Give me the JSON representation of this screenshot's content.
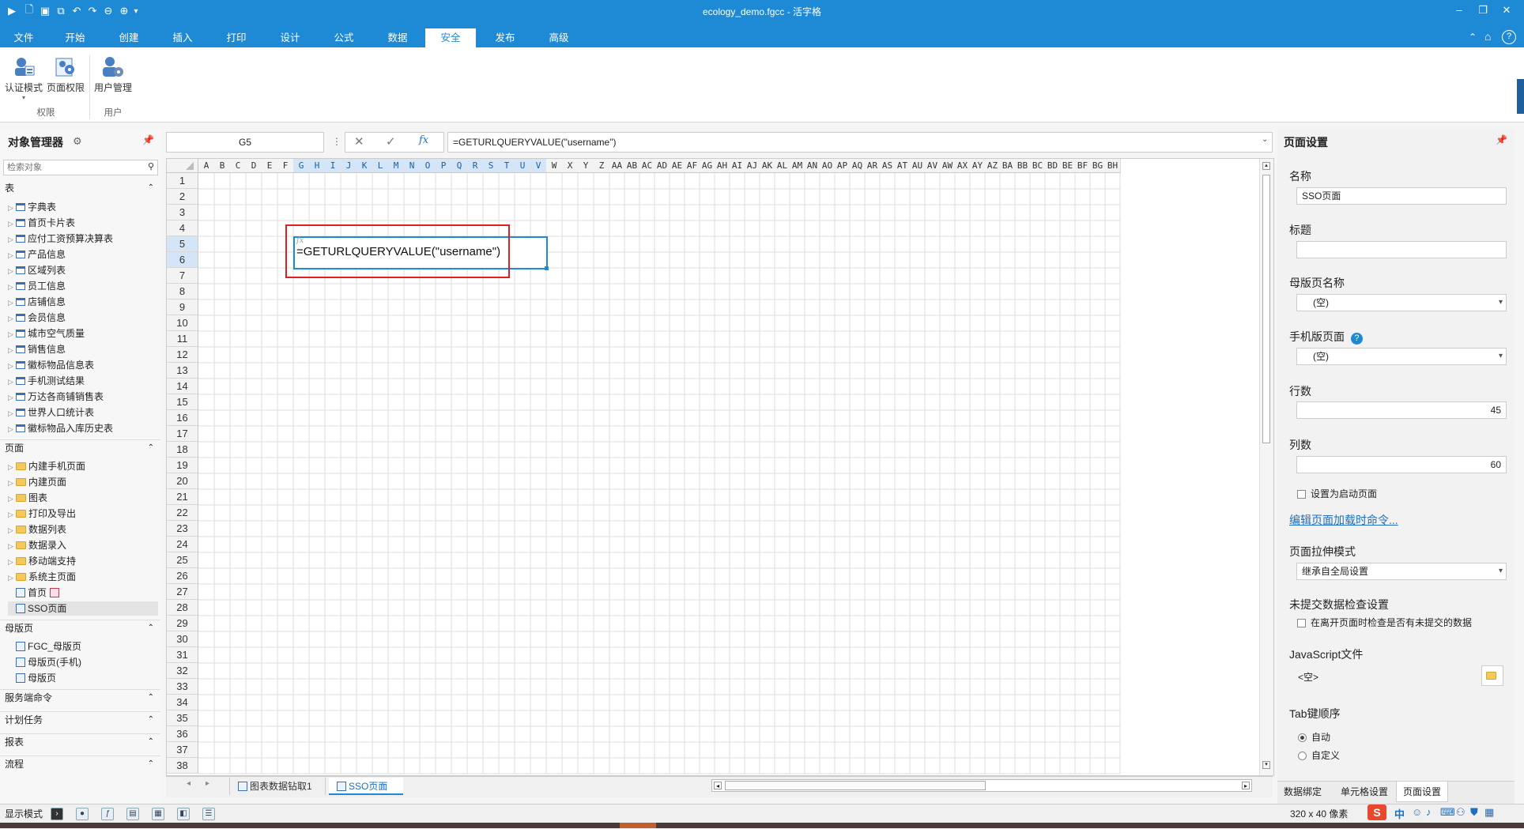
{
  "window": {
    "title": "ecology_demo.fgcc - 活字格",
    "controls": [
      "minimize-icon",
      "restore-icon",
      "close-icon"
    ]
  },
  "quick_access": [
    "run-icon",
    "new-icon",
    "save-icon",
    "open-icon",
    "undo-icon",
    "redo-icon",
    "back-icon",
    "forward-icon",
    "customize-icon"
  ],
  "menu": {
    "items": [
      "文件",
      "开始",
      "创建",
      "插入",
      "打印",
      "设计",
      "公式",
      "数据",
      "安全",
      "发布",
      "高级"
    ],
    "active": "安全"
  },
  "ribbon": {
    "buttons": [
      {
        "label": "认证模式",
        "icon": "auth-mode-icon"
      },
      {
        "label": "页面权限",
        "icon": "page-permission-icon"
      },
      {
        "label": "用户管理",
        "icon": "user-management-icon"
      }
    ],
    "groups": [
      "权限",
      "用户"
    ]
  },
  "object_manager": {
    "title": "对象管理器",
    "search_placeholder": "检索对象",
    "sections": {
      "tables": {
        "label": "表",
        "items": [
          "字典表",
          "首页卡片表",
          "应付工资预算决算表",
          "产品信息",
          "区域列表",
          "员工信息",
          "店铺信息",
          "会员信息",
          "城市空气质量",
          "销售信息",
          "徽标物品信息表",
          "手机测试结果",
          "万达各商铺销售表",
          "世界人口统计表",
          "徽标物品入库历史表"
        ]
      },
      "pages": {
        "label": "页面",
        "folders": [
          "内建手机页面",
          "内建页面",
          "图表",
          "打印及导出",
          "数据列表",
          "数据录入",
          "移动端支持",
          "系统主页面"
        ],
        "pages": [
          "首页",
          "SSO页面"
        ]
      },
      "master_pages": {
        "label": "母版页",
        "items": [
          "FGC_母版页",
          "母版页(手机)",
          "母版页"
        ]
      },
      "collapsed": [
        "服务端命令",
        "计划任务",
        "报表",
        "流程"
      ]
    }
  },
  "formula_bar": {
    "cell_ref": "G5",
    "formula": "=GETURLQUERYVALUE(\"username\")",
    "fx_label": "fx"
  },
  "grid": {
    "columns": [
      "A",
      "B",
      "C",
      "D",
      "E",
      "F",
      "G",
      "H",
      "I",
      "J",
      "K",
      "L",
      "M",
      "N",
      "O",
      "P",
      "Q",
      "R",
      "S",
      "T",
      "U",
      "V",
      "W",
      "X",
      "Y",
      "Z",
      "AA",
      "AB",
      "AC",
      "AD",
      "AE",
      "AF",
      "AG",
      "AH",
      "AI",
      "AJ",
      "AK",
      "AL",
      "AM",
      "AN",
      "AO",
      "AP",
      "AQ",
      "AR",
      "AS",
      "AT",
      "AU",
      "AV",
      "AW",
      "AX",
      "AY",
      "AZ",
      "BA",
      "BB",
      "BC",
      "BD",
      "BE",
      "BF",
      "BG",
      "BH"
    ],
    "rows": [
      "1",
      "2",
      "3",
      "4",
      "5",
      "6",
      "7",
      "8",
      "9",
      "10",
      "11",
      "12",
      "13",
      "14",
      "15",
      "16",
      "17",
      "18",
      "19",
      "20",
      "21",
      "22",
      "23",
      "24",
      "25",
      "26",
      "27",
      "28",
      "29",
      "30",
      "31",
      "32",
      "33",
      "34",
      "35",
      "36",
      "37",
      "38"
    ],
    "selected_cols": [
      "G",
      "H",
      "I",
      "J",
      "K",
      "L",
      "M",
      "N",
      "O",
      "P",
      "Q",
      "R",
      "S",
      "T",
      "U",
      "V"
    ],
    "selected_rows": [
      "5",
      "6"
    ],
    "cell_content": "=GETURLQUERYVALUE(\"username\")",
    "cell_fx_marker": "fx",
    "highlight_color": "#e02020",
    "selection_color": "#1e8ad6"
  },
  "sheet_tabs": {
    "tabs": [
      "图表数据钻取1",
      "SSO页面"
    ],
    "active": "SSO页面"
  },
  "page_settings": {
    "title": "页面设置",
    "name_label": "名称",
    "name_value": "SSO页面",
    "caption_label": "标题",
    "caption_value": "",
    "master_label": "母版页名称",
    "master_value": "(空)",
    "mobile_label": "手机版页面",
    "mobile_value": "(空)",
    "rows_label": "行数",
    "rows_value": "45",
    "cols_label": "列数",
    "cols_value": "60",
    "startup_label": "设置为启动页面",
    "edit_load_cmd": "编辑页面加载时命令...",
    "stretch_label": "页面拉伸模式",
    "stretch_value": "继承自全局设置",
    "unsubmitted_label": "未提交数据检查设置",
    "unsubmitted_check": "在离开页面时检查是否有未提交的数据",
    "js_label": "JavaScript文件",
    "js_value": "<空>",
    "tab_order_label": "Tab键顺序",
    "tab_auto": "自动",
    "tab_custom": "自定义",
    "bottom_tabs": [
      "数据绑定",
      "单元格设置",
      "页面设置"
    ],
    "bottom_active": "页面设置"
  },
  "status_bar": {
    "display_mode": "显示模式",
    "size": "320 x 40 像素",
    "ime": "中"
  }
}
